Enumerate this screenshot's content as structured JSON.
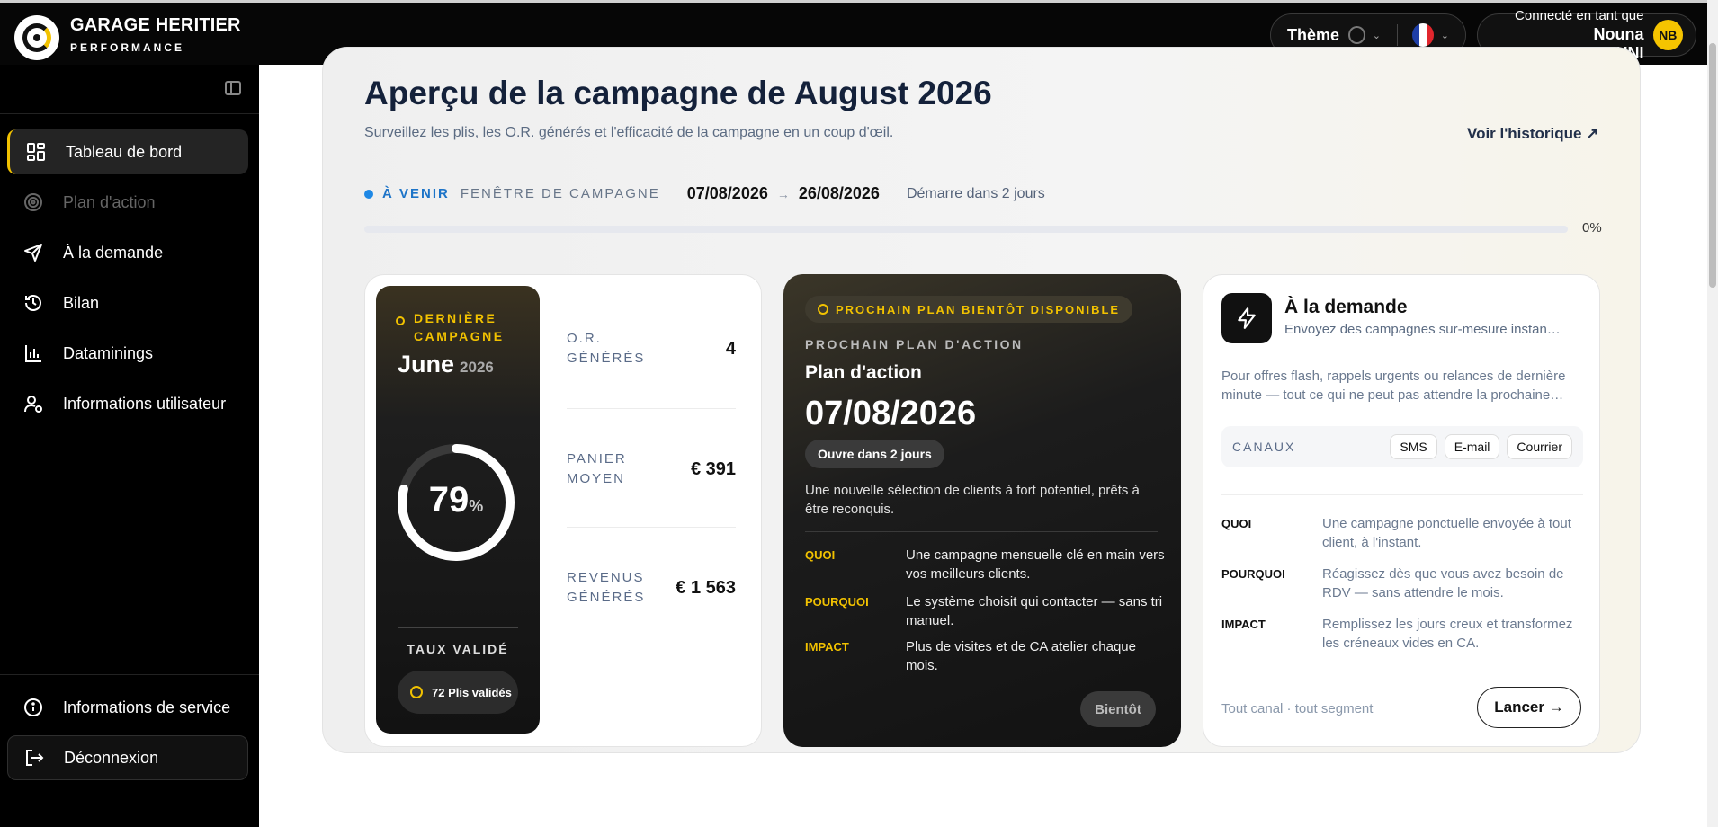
{
  "header": {
    "brand_name": "GARAGE HERITIER",
    "brand_sub": "PERFORMANCE",
    "theme_label": "Thème",
    "user_line1": "Connecté en tant que",
    "user_name": "Nouna BELAIDOUNI",
    "avatar_initials": "NB"
  },
  "sidebar": {
    "items": [
      {
        "label": "Tableau de bord",
        "icon": "dashboard-icon",
        "state": "active"
      },
      {
        "label": "Plan d'action",
        "icon": "target-icon",
        "state": "disabled"
      },
      {
        "label": "À la demande",
        "icon": "send-icon",
        "state": "normal"
      },
      {
        "label": "Bilan",
        "icon": "history-icon",
        "state": "normal"
      },
      {
        "label": "Dataminings",
        "icon": "bar-chart-icon",
        "state": "normal"
      },
      {
        "label": "Informations utilisateur",
        "icon": "user-settings-icon",
        "state": "normal"
      }
    ],
    "bottom": [
      {
        "label": "Informations de service",
        "icon": "info-icon"
      },
      {
        "label": "Déconnexion",
        "icon": "logout-icon"
      }
    ]
  },
  "main": {
    "title": "Aperçu de la campagne de August 2026",
    "subtitle": "Surveillez les plis, les O.R. générés et l'efficacité de la campagne en un coup d'œil.",
    "history_link": "Voir l'historique ↗",
    "status": "À VENIR",
    "window_label": "FENÊTRE DE CAMPAGNE",
    "date_start": "07/08/2026",
    "date_end": "26/08/2026",
    "starts_in": "Démarre dans 2 jours",
    "progress_pct": 0,
    "progress_label": "0%"
  },
  "last_campaign": {
    "tag": "DERNIÈRE CAMPAGNE",
    "month": "June",
    "year": "2026",
    "rate_value": "79",
    "rate_unit": "%",
    "rate_fraction": 0.79,
    "rate_label": "TAUX VALIDÉ",
    "plis_label": "72 Plis validés",
    "stats": [
      {
        "label": "O.R. GÉNÉRÉS",
        "value": "4"
      },
      {
        "label": "PANIER MOYEN",
        "value": "€ 391"
      },
      {
        "label": "REVENUS GÉNÉRÉS",
        "value": "€ 1 563"
      }
    ]
  },
  "next_plan": {
    "badge": "PROCHAIN PLAN BIENTÔT DISPONIBLE",
    "label": "PROCHAIN PLAN D'ACTION",
    "title": "Plan d'action",
    "date": "07/08/2026",
    "opens": "Ouvre dans 2 jours",
    "description": "Une nouvelle sélection de clients à fort potentiel, prêts à être reconquis.",
    "rows": [
      {
        "k": "QUOI",
        "v": "Une campagne mensuelle clé en main vers vos meilleurs clients."
      },
      {
        "k": "POURQUOI",
        "v": "Le système choisit qui contacter — sans tri manuel."
      },
      {
        "k": "IMPACT",
        "v": "Plus de visites et de CA atelier chaque mois."
      }
    ],
    "button": "Bientôt"
  },
  "on_demand": {
    "title": "À la demande",
    "subtitle": "Envoyez des campagnes sur-mesure instan…",
    "description": "Pour offres flash, rappels urgents ou relances de dernière minute — tout ce qui ne peut pas attendre la prochaine…",
    "channels_label": "CANAUX",
    "channels": [
      "SMS",
      "E-mail",
      "Courrier"
    ],
    "rows": [
      {
        "k": "QUOI",
        "v": "Une campagne ponctuelle envoyée à tout client, à l'instant."
      },
      {
        "k": "POURQUOI",
        "v": "Réagissez dès que vous avez besoin de RDV — sans attendre le mois."
      },
      {
        "k": "IMPACT",
        "v": "Remplissez les jours creux et transformez les créneaux vides en CA."
      }
    ],
    "footer": "Tout canal · tout segment",
    "button": "Lancer →"
  },
  "colors": {
    "accent": "#f2c200",
    "status_blue": "#1e88e5",
    "dark": "#060606"
  }
}
